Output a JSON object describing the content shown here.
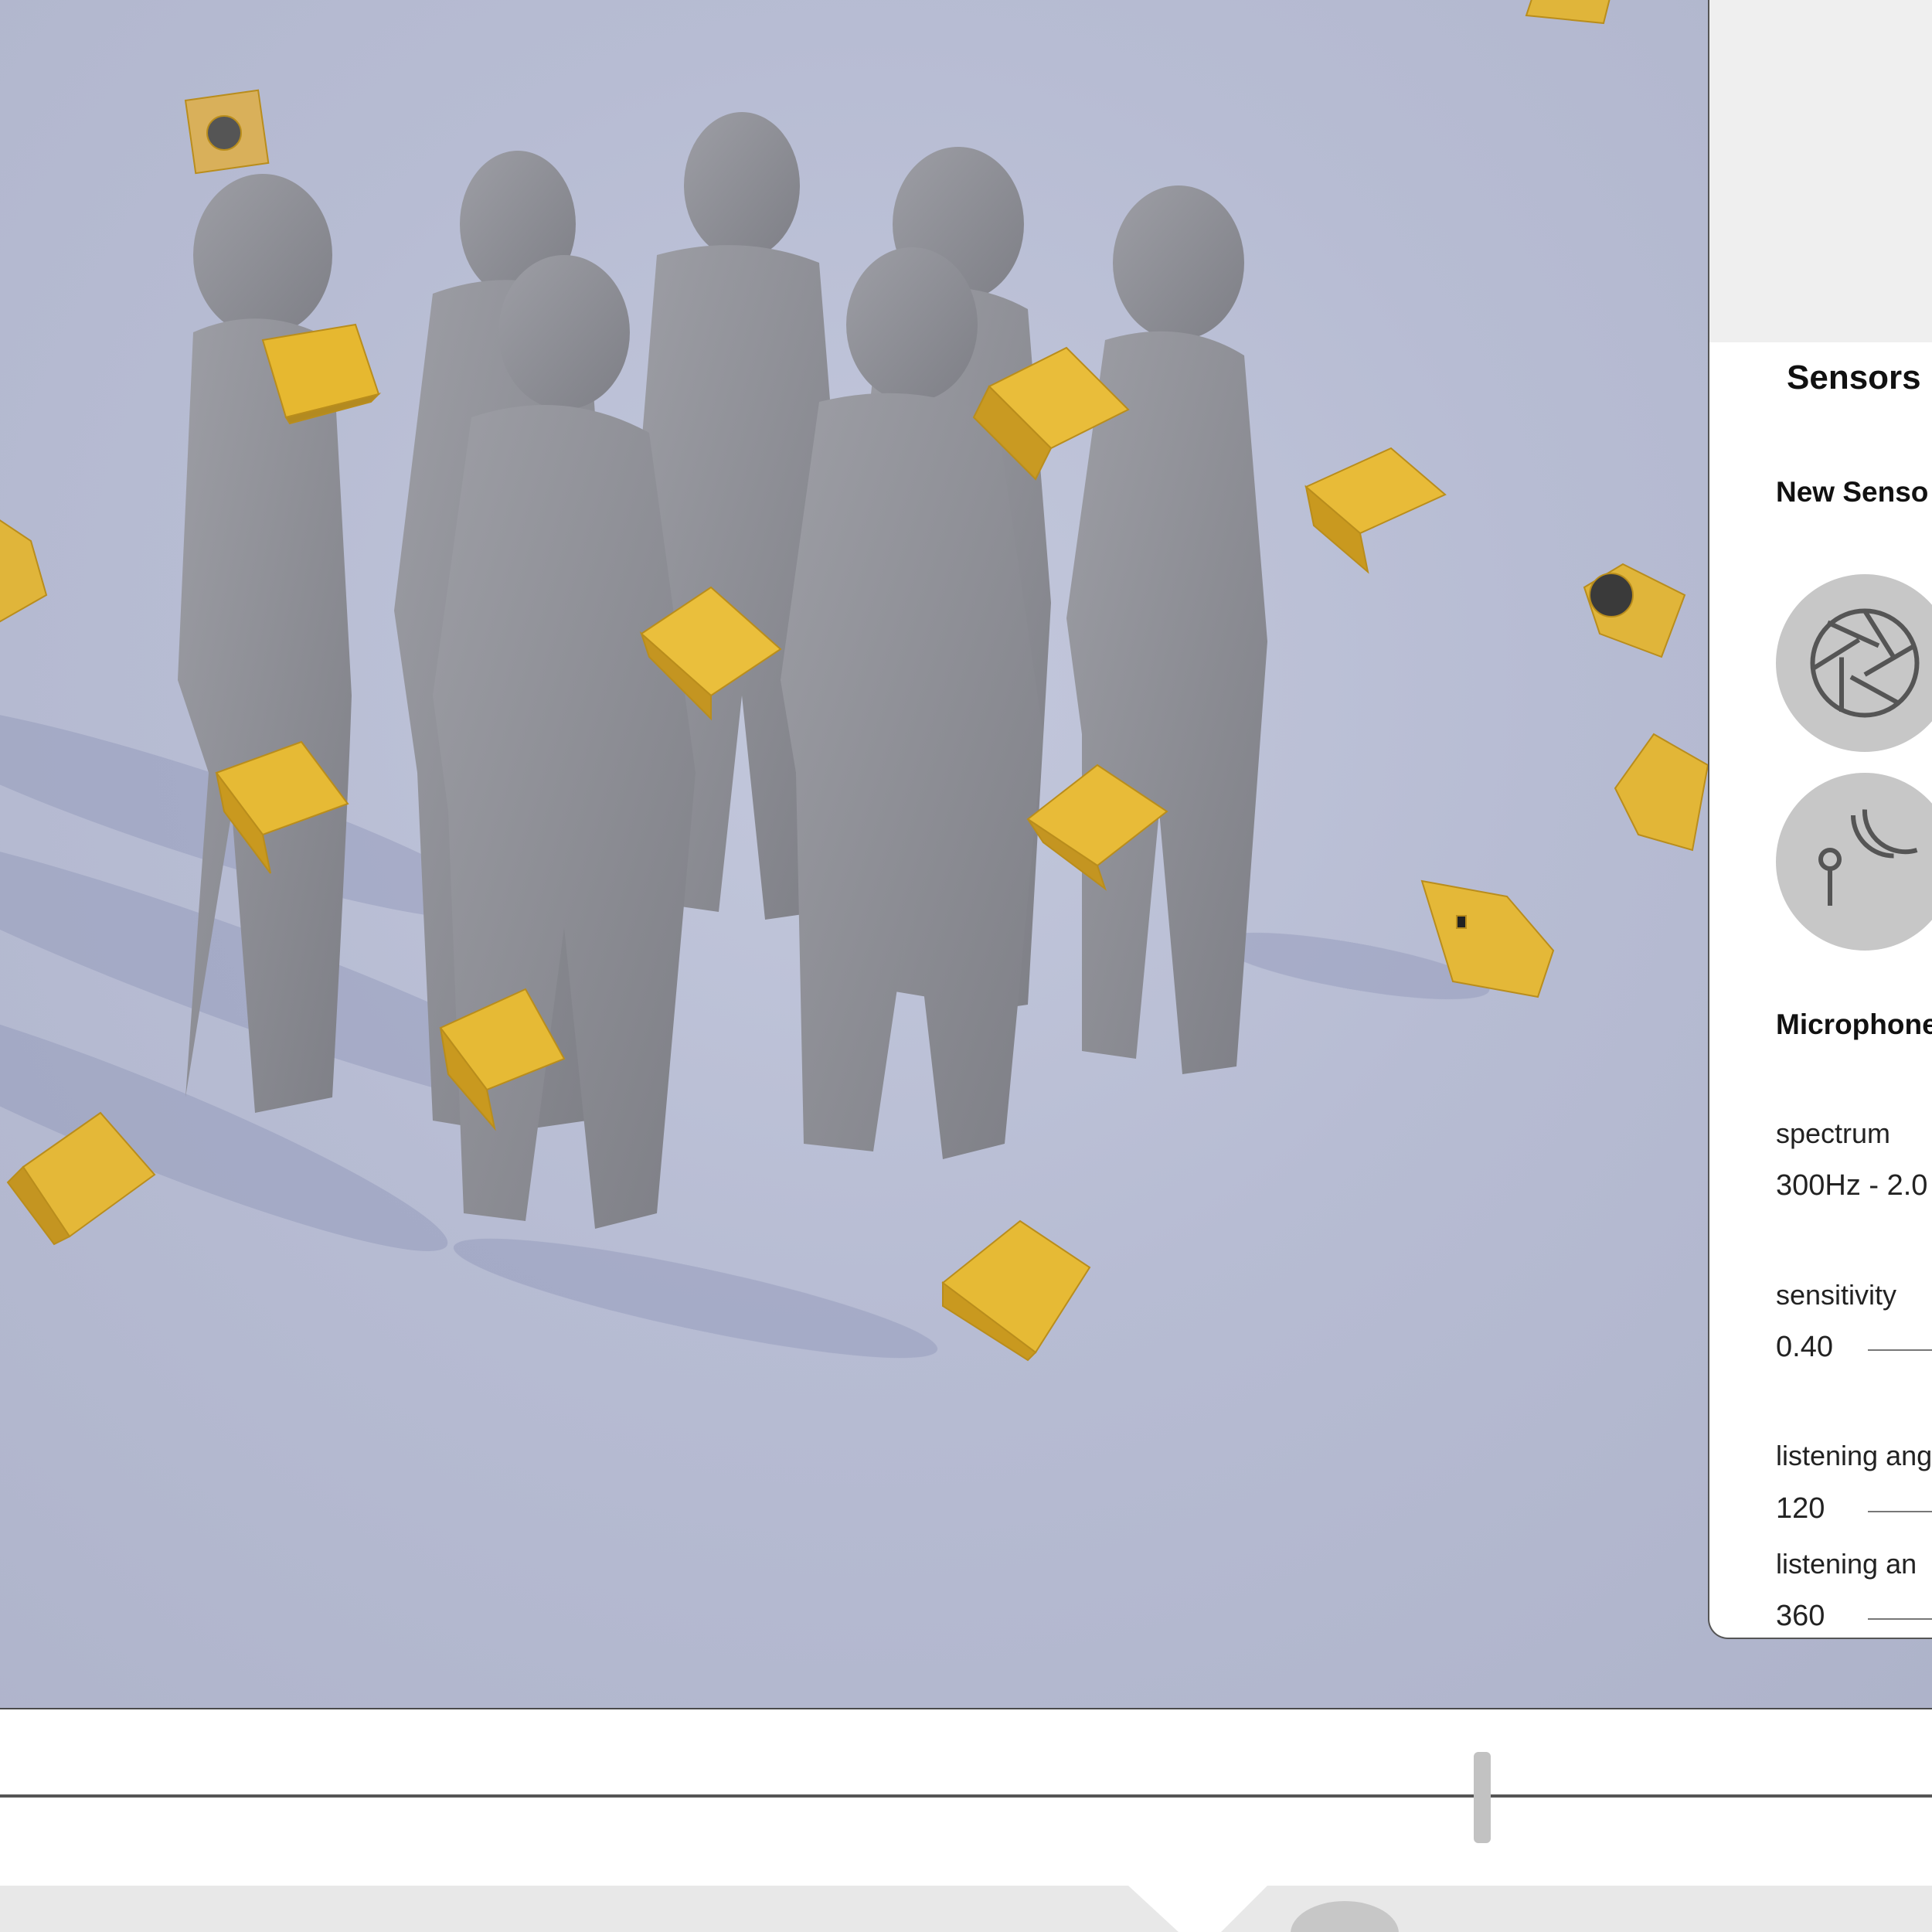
{
  "panel": {
    "title": "Sensors",
    "new_sensor_label": "New Senso",
    "sensor_types": [
      {
        "name": "camera",
        "icon": "camera-aperture-icon"
      },
      {
        "name": "microphone",
        "icon": "microphone-icon"
      }
    ],
    "section_label": "Microphone",
    "fields": {
      "spectrum_label": "spectrum",
      "spectrum_value": "300Hz - 2.0",
      "sensitivity_label": "sensitivity",
      "sensitivity_value": "0.40",
      "listening_angle_label": "listening ang",
      "listening_angle_value": "120",
      "listening_angle2_label": "listening an",
      "listening_angle2_value": "360"
    }
  },
  "timeline": {
    "scrubber_position": 0.767
  },
  "colors": {
    "viewport": "#b9bed4",
    "figure": "#8d8e95",
    "sensor_cube": "#e0b53a",
    "panel": "#ffffff"
  }
}
